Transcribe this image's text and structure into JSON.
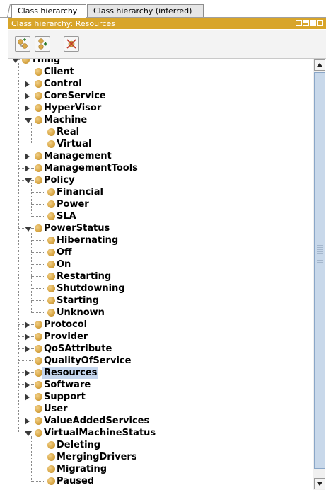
{
  "tabs": [
    {
      "label": "Class hierarchy",
      "active": true
    },
    {
      "label": "Class hierarchy (inferred)",
      "active": false
    }
  ],
  "panel": {
    "title": "Class hierarchy: Resources"
  },
  "toolbar": {
    "buttons": [
      {
        "icon": "add-subclass-icon"
      },
      {
        "icon": "add-sibling-class-icon"
      },
      {
        "icon": "delete-class-icon"
      }
    ]
  },
  "colors": {
    "title_bar": "#d8a52a",
    "class_dot": "#d9a847",
    "selection": "#c5d6ee"
  },
  "tree": {
    "selected": "Resources",
    "items": [
      {
        "label": "Thing",
        "level": 0,
        "toggle": "expanded"
      },
      {
        "label": "Client",
        "level": 1,
        "toggle": "none"
      },
      {
        "label": "Control",
        "level": 1,
        "toggle": "collapsed"
      },
      {
        "label": "CoreService",
        "level": 1,
        "toggle": "collapsed"
      },
      {
        "label": "HyperVisor",
        "level": 1,
        "toggle": "collapsed"
      },
      {
        "label": "Machine",
        "level": 1,
        "toggle": "expanded"
      },
      {
        "label": "Real",
        "level": 2,
        "toggle": "none"
      },
      {
        "label": "Virtual",
        "level": 2,
        "toggle": "none"
      },
      {
        "label": "Management",
        "level": 1,
        "toggle": "collapsed"
      },
      {
        "label": "ManagementTools",
        "level": 1,
        "toggle": "collapsed"
      },
      {
        "label": "Policy",
        "level": 1,
        "toggle": "expanded"
      },
      {
        "label": "Financial",
        "level": 2,
        "toggle": "none"
      },
      {
        "label": "Power",
        "level": 2,
        "toggle": "none"
      },
      {
        "label": "SLA",
        "level": 2,
        "toggle": "none"
      },
      {
        "label": "PowerStatus",
        "level": 1,
        "toggle": "expanded"
      },
      {
        "label": "Hibernating",
        "level": 2,
        "toggle": "none"
      },
      {
        "label": "Off",
        "level": 2,
        "toggle": "none"
      },
      {
        "label": "On",
        "level": 2,
        "toggle": "none"
      },
      {
        "label": "Restarting",
        "level": 2,
        "toggle": "none"
      },
      {
        "label": "Shutdowning",
        "level": 2,
        "toggle": "none"
      },
      {
        "label": "Starting",
        "level": 2,
        "toggle": "none"
      },
      {
        "label": "Unknown",
        "level": 2,
        "toggle": "none"
      },
      {
        "label": "Protocol",
        "level": 1,
        "toggle": "collapsed"
      },
      {
        "label": "Provider",
        "level": 1,
        "toggle": "collapsed"
      },
      {
        "label": "QoSAttribute",
        "level": 1,
        "toggle": "collapsed"
      },
      {
        "label": "QualityOfService",
        "level": 1,
        "toggle": "none"
      },
      {
        "label": "Resources",
        "level": 1,
        "toggle": "collapsed"
      },
      {
        "label": "Software",
        "level": 1,
        "toggle": "collapsed"
      },
      {
        "label": "Support",
        "level": 1,
        "toggle": "collapsed"
      },
      {
        "label": "User",
        "level": 1,
        "toggle": "none"
      },
      {
        "label": "ValueAddedServices",
        "level": 1,
        "toggle": "collapsed"
      },
      {
        "label": "VirtualMachineStatus",
        "level": 1,
        "toggle": "expanded"
      },
      {
        "label": "Deleting",
        "level": 2,
        "toggle": "none"
      },
      {
        "label": "MergingDrivers",
        "level": 2,
        "toggle": "none"
      },
      {
        "label": "Migrating",
        "level": 2,
        "toggle": "none"
      },
      {
        "label": "Paused",
        "level": 2,
        "toggle": "none"
      }
    ]
  }
}
